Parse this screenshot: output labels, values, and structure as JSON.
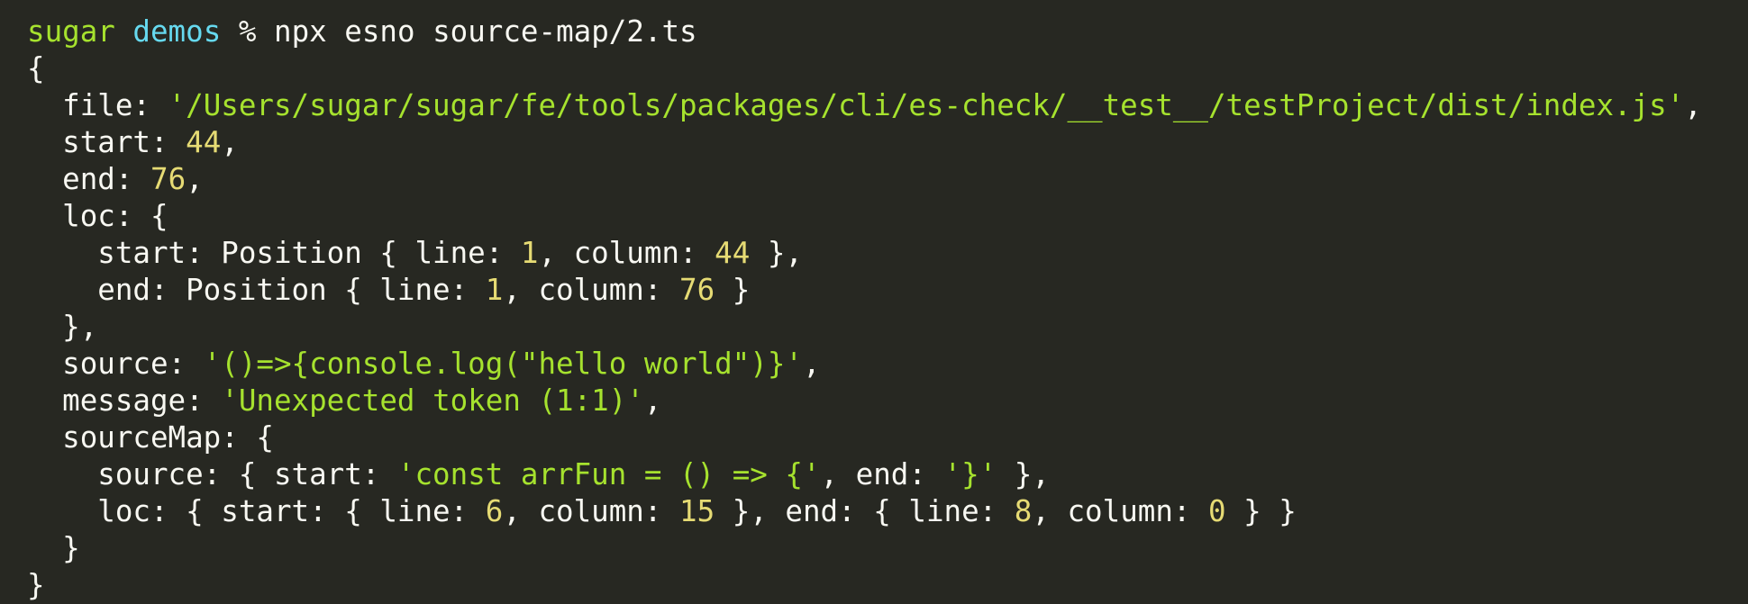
{
  "prompt": {
    "user": "sugar",
    "directory": "demos",
    "symbol": "%",
    "command": "npx esno source-map/2.ts"
  },
  "output": {
    "open_brace": "{",
    "file_key": "file:",
    "file_value": "'/Users/sugar/sugar/fe/tools/packages/cli/es-check/__test__/testProject/dist/index.js'",
    "start_key": "start:",
    "start_value": "44",
    "end_key": "end:",
    "end_value": "76",
    "loc_open": "loc: {",
    "loc_start_prefix": "start: Position { line: ",
    "loc_start_line": "1",
    "loc_start_mid": ", column: ",
    "loc_start_column": "44",
    "loc_start_suffix": " },",
    "loc_end_prefix": "end: Position { line: ",
    "loc_end_line": "1",
    "loc_end_mid": ", column: ",
    "loc_end_column": "76",
    "loc_end_suffix": " }",
    "loc_close": "},",
    "source_key": "source:",
    "source_value": "'()=>{console.log(\"hello world\")}'",
    "message_key": "message:",
    "message_value": "'Unexpected token (1:1)'",
    "sourcemap_open": "sourceMap: {",
    "sm_source_prefix": "source: { start: ",
    "sm_source_start": "'const arrFun = () => {'",
    "sm_source_mid": ", end: ",
    "sm_source_end": "'}'",
    "sm_source_suffix": " },",
    "sm_loc_prefix": "loc: { start: { line: ",
    "sm_loc_start_line": "6",
    "sm_loc_mid1": ", column: ",
    "sm_loc_start_column": "15",
    "sm_loc_mid2": " }, end: { line: ",
    "sm_loc_end_line": "8",
    "sm_loc_mid3": ", column: ",
    "sm_loc_end_column": "0",
    "sm_loc_suffix": " } }",
    "sourcemap_close": "}",
    "close_brace": "}"
  },
  "colors": {
    "background": "#272822",
    "foreground": "#f8f8f2",
    "string": "#a6e22e",
    "number": "#e6db74",
    "directory": "#66d9ef"
  }
}
